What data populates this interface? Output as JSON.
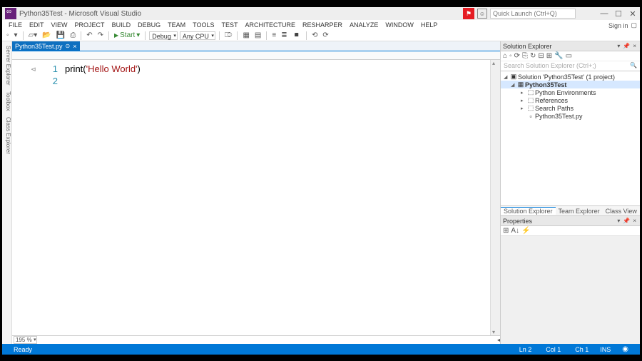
{
  "title": "Python35Test - Microsoft Visual Studio",
  "quicklaunch_placeholder": "Quick Launch (Ctrl+Q)",
  "signin": "Sign in",
  "menu": [
    "FILE",
    "EDIT",
    "VIEW",
    "PROJECT",
    "BUILD",
    "DEBUG",
    "TEAM",
    "TOOLS",
    "TEST",
    "ARCHITECTURE",
    "RESHARPER",
    "ANALYZE",
    "WINDOW",
    "HELP"
  ],
  "toolbar": {
    "start": "Start",
    "config": "Debug",
    "platform": "Any CPU"
  },
  "left_tabs": [
    "Server Explorer",
    "Toolbox",
    "Class Explorer"
  ],
  "tab": {
    "name": "Python35Test.py"
  },
  "code": {
    "lines": [
      {
        "n": "1",
        "text_pre": "print(",
        "str": "'Hello World'",
        "text_post": ")"
      },
      {
        "n": "2",
        "text_pre": "",
        "str": "",
        "text_post": ""
      }
    ]
  },
  "zoom": "195 %",
  "solution": {
    "panel_title": "Solution Explorer",
    "search_placeholder": "Search Solution Explorer (Ctrl+;)",
    "root": "Solution 'Python35Test' (1 project)",
    "project": "Python35Test",
    "nodes": [
      "Python Environments",
      "References",
      "Search Paths",
      "Python35Test.py"
    ],
    "tabs": [
      "Solution Explorer",
      "Team Explorer",
      "Class View"
    ]
  },
  "properties": {
    "title": "Properties"
  },
  "status": {
    "ready": "Ready",
    "ln": "Ln 2",
    "col": "Col 1",
    "ch": "Ch 1",
    "ins": "INS"
  }
}
